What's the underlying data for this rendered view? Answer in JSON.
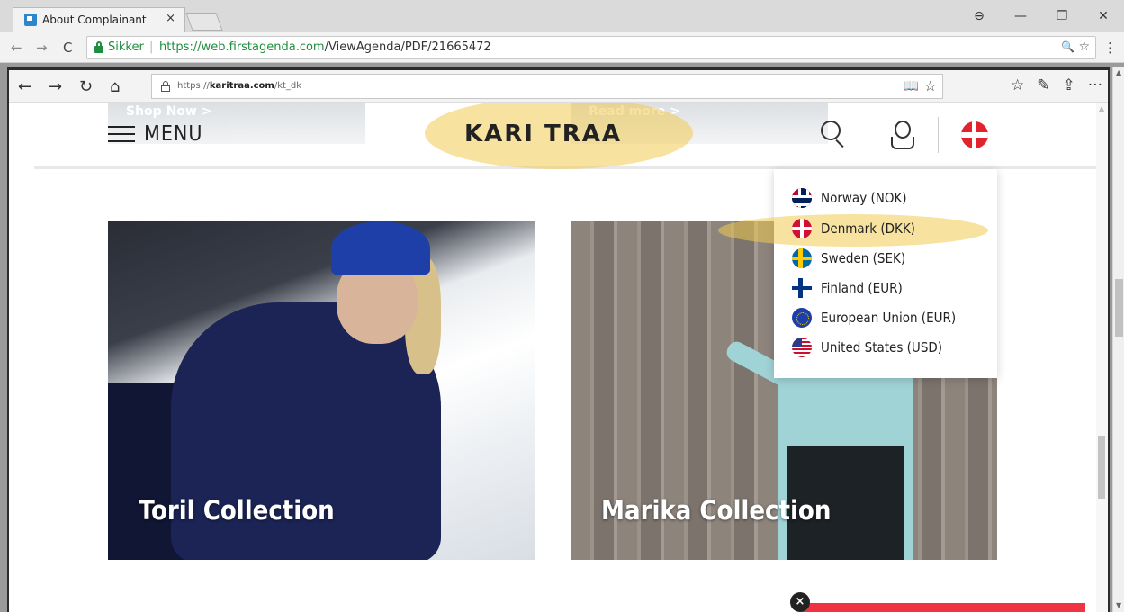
{
  "chrome": {
    "tab_title": "About Complainant",
    "tab_close": "×",
    "window_controls": {
      "account": "⊖",
      "minimize": "—",
      "restore": "❐",
      "close": "✕"
    },
    "nav": {
      "back": "←",
      "forward": "→",
      "reload": "C"
    },
    "omnibox": {
      "secure_label": "Sikker",
      "url_scheme": "https://",
      "url_host": "web.firstagenda.com",
      "url_path": "/ViewAgenda/PDF/21665472"
    },
    "omnibox_icons": {
      "zoom": "🔍",
      "star": "☆"
    },
    "menu": "⋮"
  },
  "edge": {
    "buttons": {
      "back": "←",
      "forward": "→",
      "refresh": "↻",
      "home": "⌂"
    },
    "url_prefix": "https://",
    "url_host": "karitraa.com",
    "url_path": "/kt_dk",
    "reading_view": "📖",
    "favorite": "☆",
    "right_icons": {
      "favorites": "☆",
      "notes": "✎",
      "share": "⇪",
      "more": "···"
    }
  },
  "site": {
    "hero_ghost_left": "Shop Now >",
    "hero_ghost_right": "Read more >",
    "menu_label": "MENU",
    "logo": "KARI TRAA",
    "dropdown": {
      "items": [
        {
          "label": "Norway (NOK)",
          "flag": "flag-no"
        },
        {
          "label": "Denmark (DKK)",
          "flag": "flag-dk"
        },
        {
          "label": "Sweden (SEK)",
          "flag": "flag-se"
        },
        {
          "label": "Finland (EUR)",
          "flag": "flag-fi"
        },
        {
          "label": "European Union (EUR)",
          "flag": "flag-eu"
        },
        {
          "label": "United States (USD)",
          "flag": "flag-us"
        }
      ]
    },
    "tiles": {
      "toril": "Toril Collection",
      "marika": "Marika Collection"
    },
    "promo_close": "×"
  },
  "colors": {
    "accent_red": "#ef3340",
    "highlight": "#f1cb52",
    "secure_green": "#1e8e3e"
  }
}
